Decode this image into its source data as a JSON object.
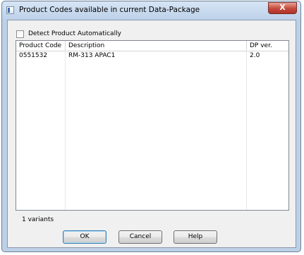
{
  "window": {
    "title": "Product Codes available in current Data-Package",
    "close_label": "X"
  },
  "detect_checkbox": {
    "label": "Detect Product Automatically",
    "checked": false
  },
  "list": {
    "columns": [
      "Product Code",
      "Description",
      "DP ver."
    ],
    "rows": [
      [
        "0551532",
        "RM-313 APAC1",
        "2.0"
      ]
    ]
  },
  "status": {
    "text": "1 variants"
  },
  "buttons": {
    "ok": "OK",
    "cancel": "Cancel",
    "help": "Help"
  }
}
